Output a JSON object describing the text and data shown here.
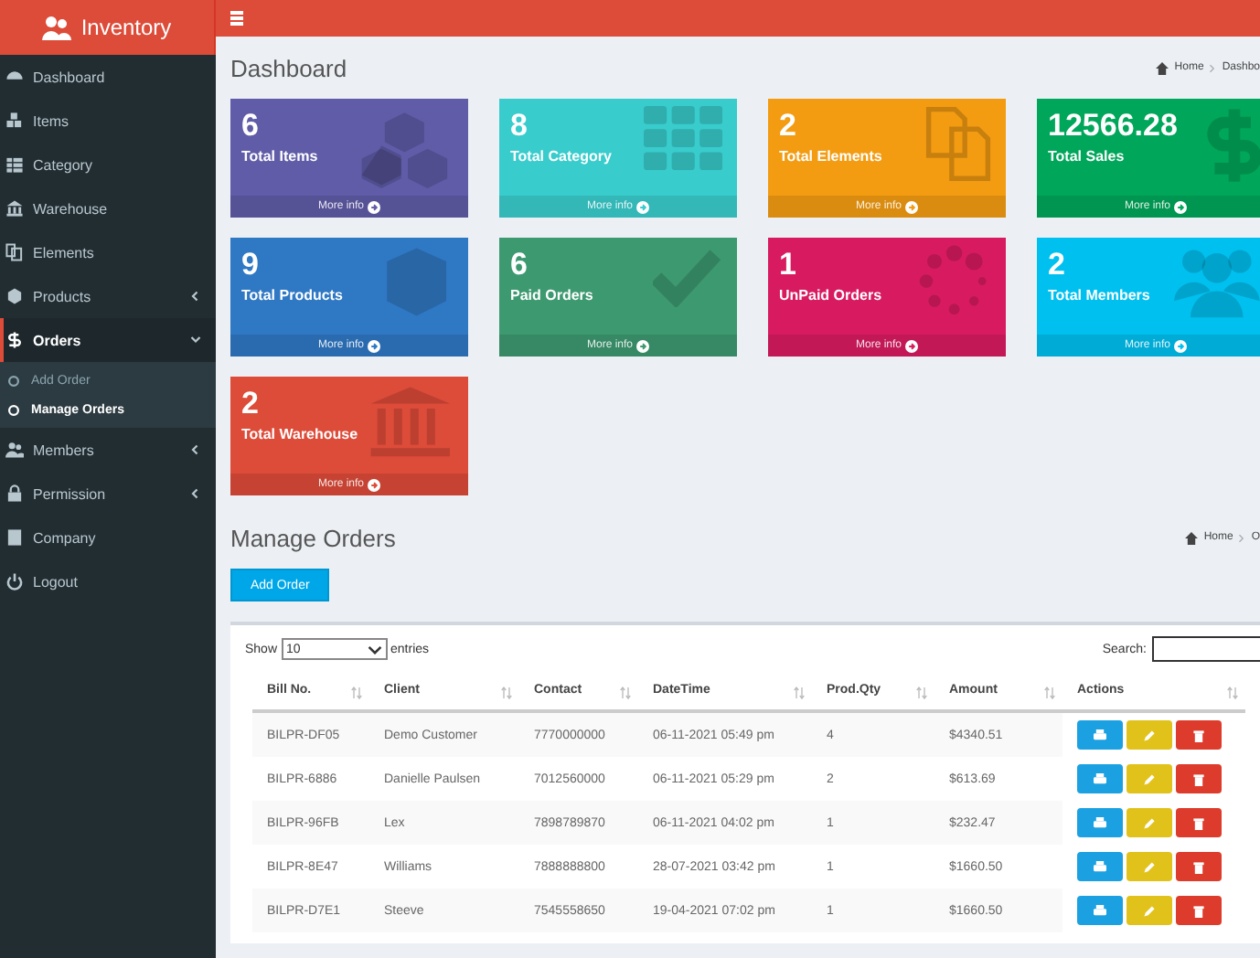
{
  "brand": {
    "title": "Inventory"
  },
  "sidebar": {
    "items": [
      {
        "label": "Dashboard",
        "selected": false
      },
      {
        "label": "Items",
        "selected": false
      },
      {
        "label": "Category",
        "selected": false
      },
      {
        "label": "Warehouse",
        "selected": false
      },
      {
        "label": "Elements",
        "selected": false
      },
      {
        "label": "Products",
        "selected": false,
        "expanded": false
      },
      {
        "label": "Orders",
        "selected": true,
        "expanded": true,
        "children": [
          {
            "label": "Add Order",
            "selected": false
          },
          {
            "label": "Manage Orders",
            "selected": true
          }
        ]
      },
      {
        "label": "Members",
        "selected": false,
        "expanded": false
      },
      {
        "label": "Permission",
        "selected": false,
        "expanded": false
      },
      {
        "label": "Company",
        "selected": false
      },
      {
        "label": "Logout",
        "selected": false
      }
    ]
  },
  "dashboard": {
    "title": "Dashboard",
    "breadcrumb": [
      "Home",
      "Dashbo"
    ],
    "cards": [
      {
        "value": "6",
        "label": "Total Items",
        "link": "More info",
        "color": "#605ca8"
      },
      {
        "value": "8",
        "label": "Total Category",
        "link": "More info",
        "color": "#39cccc"
      },
      {
        "value": "2",
        "label": "Total Elements",
        "link": "More info",
        "color": "#f39c12"
      },
      {
        "value": "12566.28",
        "label": "Total Sales",
        "link": "More info",
        "color": "#00a65a"
      },
      {
        "value": "9",
        "label": "Total Products",
        "link": "More info",
        "color": "#2f78c4"
      },
      {
        "value": "6",
        "label": "Paid Orders",
        "link": "More info",
        "color": "#3d9970"
      },
      {
        "value": "1",
        "label": "UnPaid Orders",
        "link": "More info",
        "color": "#d81b60"
      },
      {
        "value": "2",
        "label": "Total Members",
        "link": "More info",
        "color": "#00c0ef"
      },
      {
        "value": "2",
        "label": "Total Warehouse",
        "link": "More info",
        "color": "#dd4b39"
      }
    ]
  },
  "orders": {
    "title": "Manage Orders",
    "breadcrumb": [
      "Home",
      "O"
    ],
    "add_button": "Add Order",
    "show_label": "Show",
    "entries_value": "10",
    "entries_label": "entries",
    "search_label": "Search:",
    "columns": [
      "Bill No.",
      "Client",
      "Contact",
      "DateTime",
      "Prod.Qty",
      "Amount",
      "Actions"
    ],
    "rows": [
      [
        "BILPR-DF05",
        "Demo Customer",
        "7770000000",
        "06-11-2021 05:49 pm",
        "4",
        "$4340.51"
      ],
      [
        "BILPR-6886",
        "Danielle Paulsen",
        "7012560000",
        "06-11-2021 05:29 pm",
        "2",
        "$613.69"
      ],
      [
        "BILPR-96FB",
        "Lex",
        "7898789870",
        "06-11-2021 04:02 pm",
        "1",
        "$232.47"
      ],
      [
        "BILPR-8E47",
        "Williams",
        "7888888800",
        "28-07-2021 03:42 pm",
        "1",
        "$1660.50"
      ],
      [
        "BILPR-D7E1",
        "Steeve",
        "7545558650",
        "19-04-2021 07:02 pm",
        "1",
        "$1660.50"
      ]
    ]
  }
}
